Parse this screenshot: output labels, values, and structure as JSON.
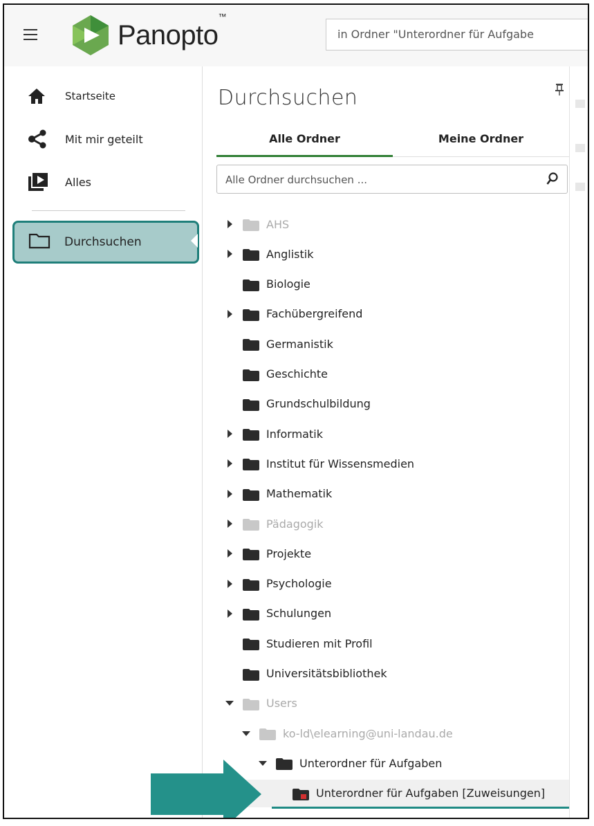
{
  "header": {
    "logo_text": "Panopto",
    "logo_tm": "™",
    "search_value": "in Ordner \"Unterordner für Aufgabe"
  },
  "nav": {
    "items": [
      {
        "label": "Startseite",
        "icon": "home-icon"
      },
      {
        "label": "Mit mir geteilt",
        "icon": "share-icon"
      },
      {
        "label": "Alles",
        "icon": "video-library-icon"
      }
    ],
    "active": {
      "label": "Durchsuchen",
      "icon": "folder-outline-icon"
    }
  },
  "panel": {
    "title": "Durchsuchen",
    "tabs": [
      {
        "label": "Alle Ordner",
        "active": true
      },
      {
        "label": "Meine Ordner",
        "active": false
      }
    ],
    "search_placeholder": "Alle Ordner durchsuchen ...",
    "folders": [
      {
        "name": "AHS",
        "expander": "collapsed",
        "dim": true,
        "level": 0
      },
      {
        "name": "Anglistik",
        "expander": "collapsed",
        "dim": false,
        "level": 0
      },
      {
        "name": "Biologie",
        "expander": "none",
        "dim": false,
        "level": 0
      },
      {
        "name": "Fachübergreifend",
        "expander": "collapsed",
        "dim": false,
        "level": 0
      },
      {
        "name": "Germanistik",
        "expander": "none",
        "dim": false,
        "level": 0
      },
      {
        "name": "Geschichte",
        "expander": "none",
        "dim": false,
        "level": 0
      },
      {
        "name": "Grundschulbildung",
        "expander": "none",
        "dim": false,
        "level": 0
      },
      {
        "name": "Informatik",
        "expander": "collapsed",
        "dim": false,
        "level": 0
      },
      {
        "name": "Institut für Wissensmedien",
        "expander": "collapsed",
        "dim": false,
        "level": 0
      },
      {
        "name": "Mathematik",
        "expander": "collapsed",
        "dim": false,
        "level": 0
      },
      {
        "name": "Pädagogik",
        "expander": "collapsed",
        "dim": true,
        "level": 0
      },
      {
        "name": "Projekte",
        "expander": "collapsed",
        "dim": false,
        "level": 0
      },
      {
        "name": "Psychologie",
        "expander": "collapsed",
        "dim": false,
        "level": 0
      },
      {
        "name": "Schulungen",
        "expander": "collapsed",
        "dim": false,
        "level": 0
      },
      {
        "name": "Studieren mit Profil",
        "expander": "none",
        "dim": false,
        "level": 0
      },
      {
        "name": "Universitätsbibliothek",
        "expander": "none",
        "dim": false,
        "level": 0
      },
      {
        "name": "Users",
        "expander": "expanded",
        "dim": true,
        "level": 0
      },
      {
        "name": "ko-ld\\elearning@uni-landau.de",
        "expander": "expanded",
        "dim": true,
        "level": 1
      },
      {
        "name": "Unterordner für Aufgaben",
        "expander": "expanded",
        "dim": false,
        "level": 2
      },
      {
        "name": "Unterordner für Aufgaben [Zuweisungen]",
        "expander": "none",
        "dim": false,
        "level": 3,
        "selected": true,
        "assignment": true
      }
    ]
  },
  "colors": {
    "accent_teal": "#1f8a84",
    "active_tab_underline": "#2e7d32",
    "folder_dark": "#2b2b2b",
    "folder_dim": "#c8c8c8",
    "assignment_badge": "#d32f2f"
  }
}
